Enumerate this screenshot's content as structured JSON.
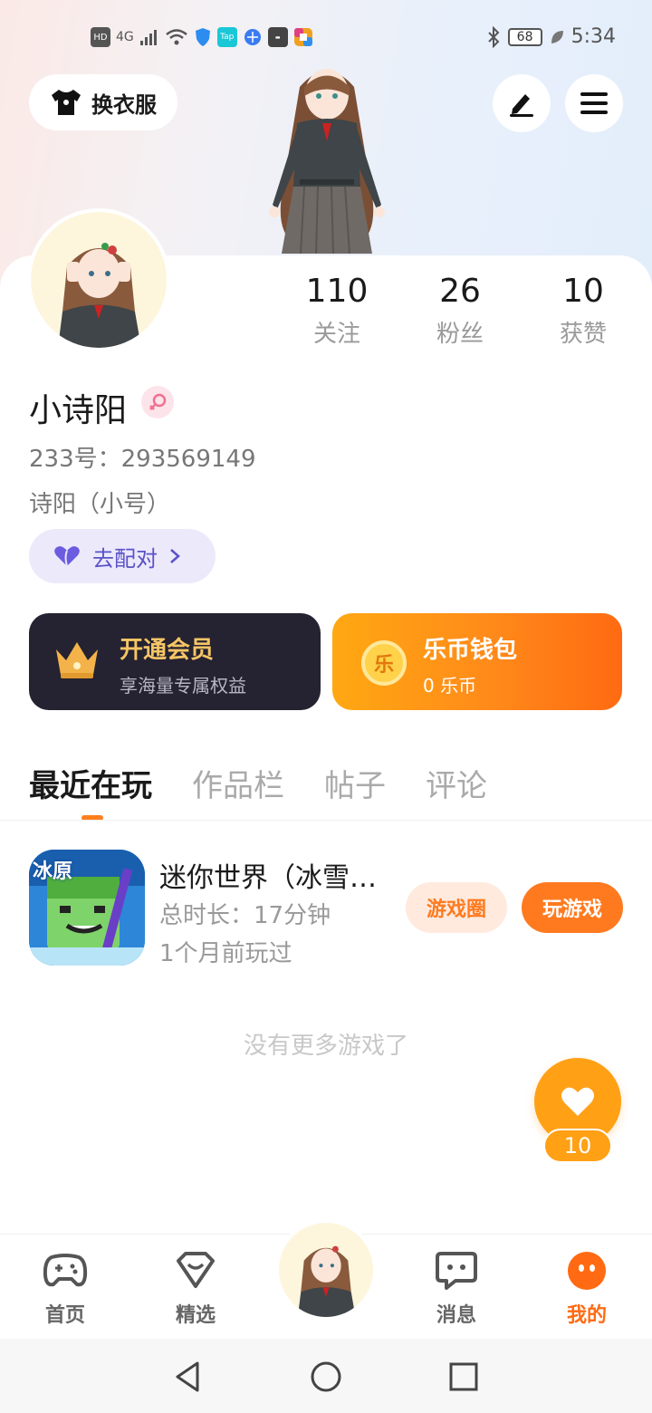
{
  "status_bar": {
    "network_hd": "HD",
    "network_gen": "4G",
    "battery": "68",
    "time": "5:34"
  },
  "header": {
    "outfit_label": "换衣服"
  },
  "profile": {
    "following_count": "110",
    "following_label": "关注",
    "followers_count": "26",
    "followers_label": "粉丝",
    "likes_count": "10",
    "likes_label": "获赞",
    "username": "小诗阳",
    "uid": "233号：293569149",
    "nickname": "诗阳（小号）",
    "match_label": "去配对"
  },
  "cards": {
    "vip_title": "开通会员",
    "vip_sub": "享海量专属权益",
    "wallet_icon_text": "乐",
    "wallet_title": "乐币钱包",
    "wallet_sub": "0 乐币"
  },
  "tabs": [
    "最近在玩",
    "作品栏",
    "帖子",
    "评论"
  ],
  "recent_game": {
    "icon_text": "冰原",
    "title": "迷你世界（冰雪…",
    "duration": "总时长：17分钟",
    "last_played": "1个月前玩过",
    "circle_button": "游戏圈",
    "play_button": "玩游戏"
  },
  "no_more_text": "没有更多游戏了",
  "like_fab": {
    "count": "10"
  },
  "bottom_nav": {
    "home": "首页",
    "featured": "精选",
    "messages": "消息",
    "mine": "我的"
  },
  "colors": {
    "accent": "#ff7a1f",
    "vip_card": "#252231",
    "match_text": "#5a52c8"
  }
}
